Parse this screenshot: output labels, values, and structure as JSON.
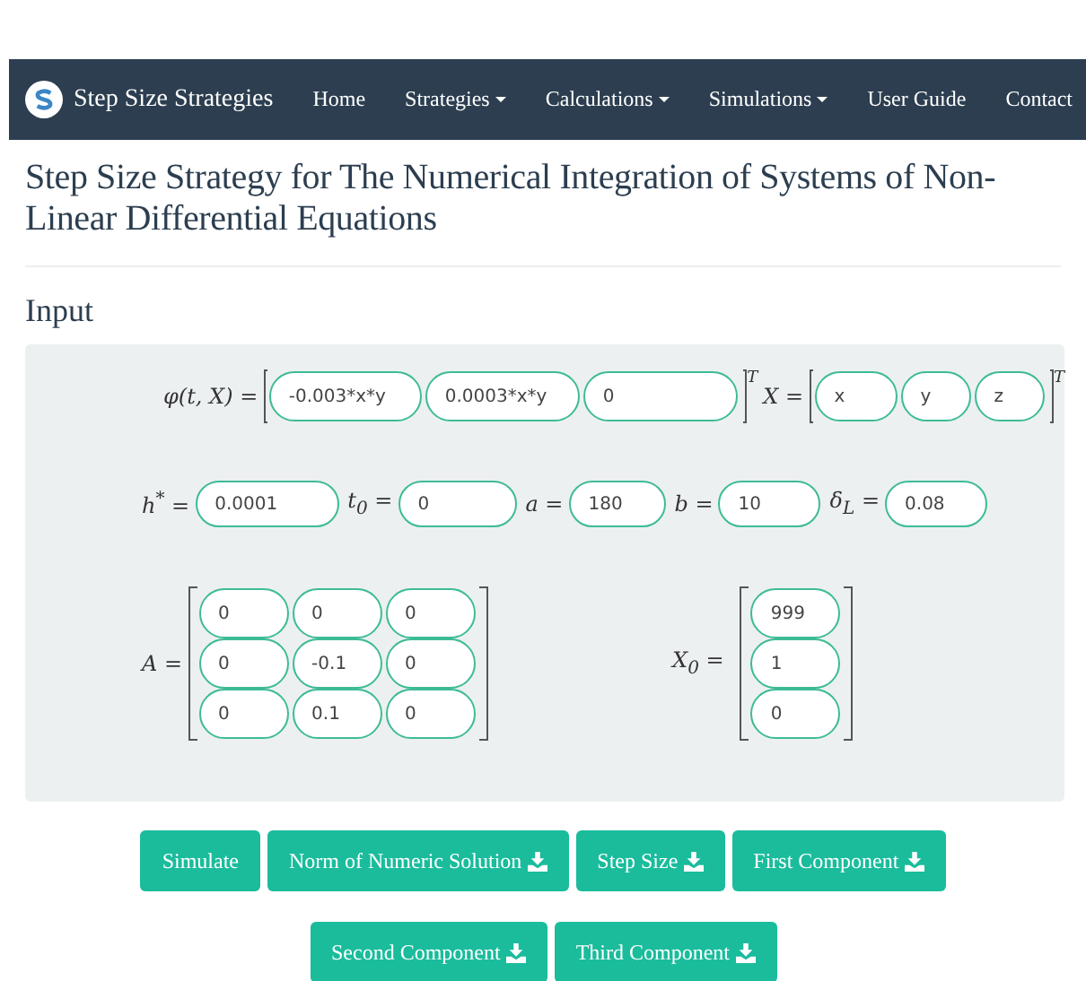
{
  "navbar": {
    "brand": "Step Size Strategies",
    "items": [
      {
        "label": "Home",
        "has_dropdown": false
      },
      {
        "label": "Strategies",
        "has_dropdown": true
      },
      {
        "label": "Calculations",
        "has_dropdown": true
      },
      {
        "label": "Simulations",
        "has_dropdown": true
      },
      {
        "label": "User Guide",
        "has_dropdown": false
      },
      {
        "label": "Contact",
        "has_dropdown": false
      }
    ]
  },
  "page_title": "Step Size Strategy for The Numerical Integration of Systems of Non-Linear Differential Equations",
  "section_title": "Input",
  "system": {
    "phi_label": "φ(t, X) =",
    "phi_fields": [
      "-0.003*x*y",
      "0.0003*x*y",
      "0"
    ],
    "phi_transpose": "T",
    "x_label": "X =",
    "x_fields": [
      "x",
      "y",
      "z"
    ],
    "x_transpose": "T"
  },
  "parameters": [
    {
      "label": "h$^{*}$ =",
      "value": "0.0001"
    },
    {
      "label": "t$_{0}$ =",
      "value": "0"
    },
    {
      "label": "a =",
      "value": "180"
    },
    {
      "label": "b =",
      "value": "10"
    },
    {
      "label": "δ$_{L}$ =",
      "value": "0.08"
    }
  ],
  "matrix_a": {
    "label": "A =",
    "rows": [
      [
        "0",
        "0",
        "0"
      ],
      [
        "0",
        "-0.1",
        "0"
      ],
      [
        "0",
        "0.1",
        "0"
      ]
    ]
  },
  "initial_x": {
    "label": "X$_{0}$ =",
    "values": [
      "999",
      "1",
      "0"
    ]
  },
  "button_rows": [
    [
      {
        "label": "Simulate",
        "download": false
      },
      {
        "label": "Norm of Numeric Solution",
        "download": true
      },
      {
        "label": "Step Size",
        "download": true
      },
      {
        "label": "First Component",
        "download": true
      }
    ],
    [
      {
        "label": "Second Component",
        "download": true
      },
      {
        "label": "Third Component",
        "download": true
      }
    ]
  ]
}
